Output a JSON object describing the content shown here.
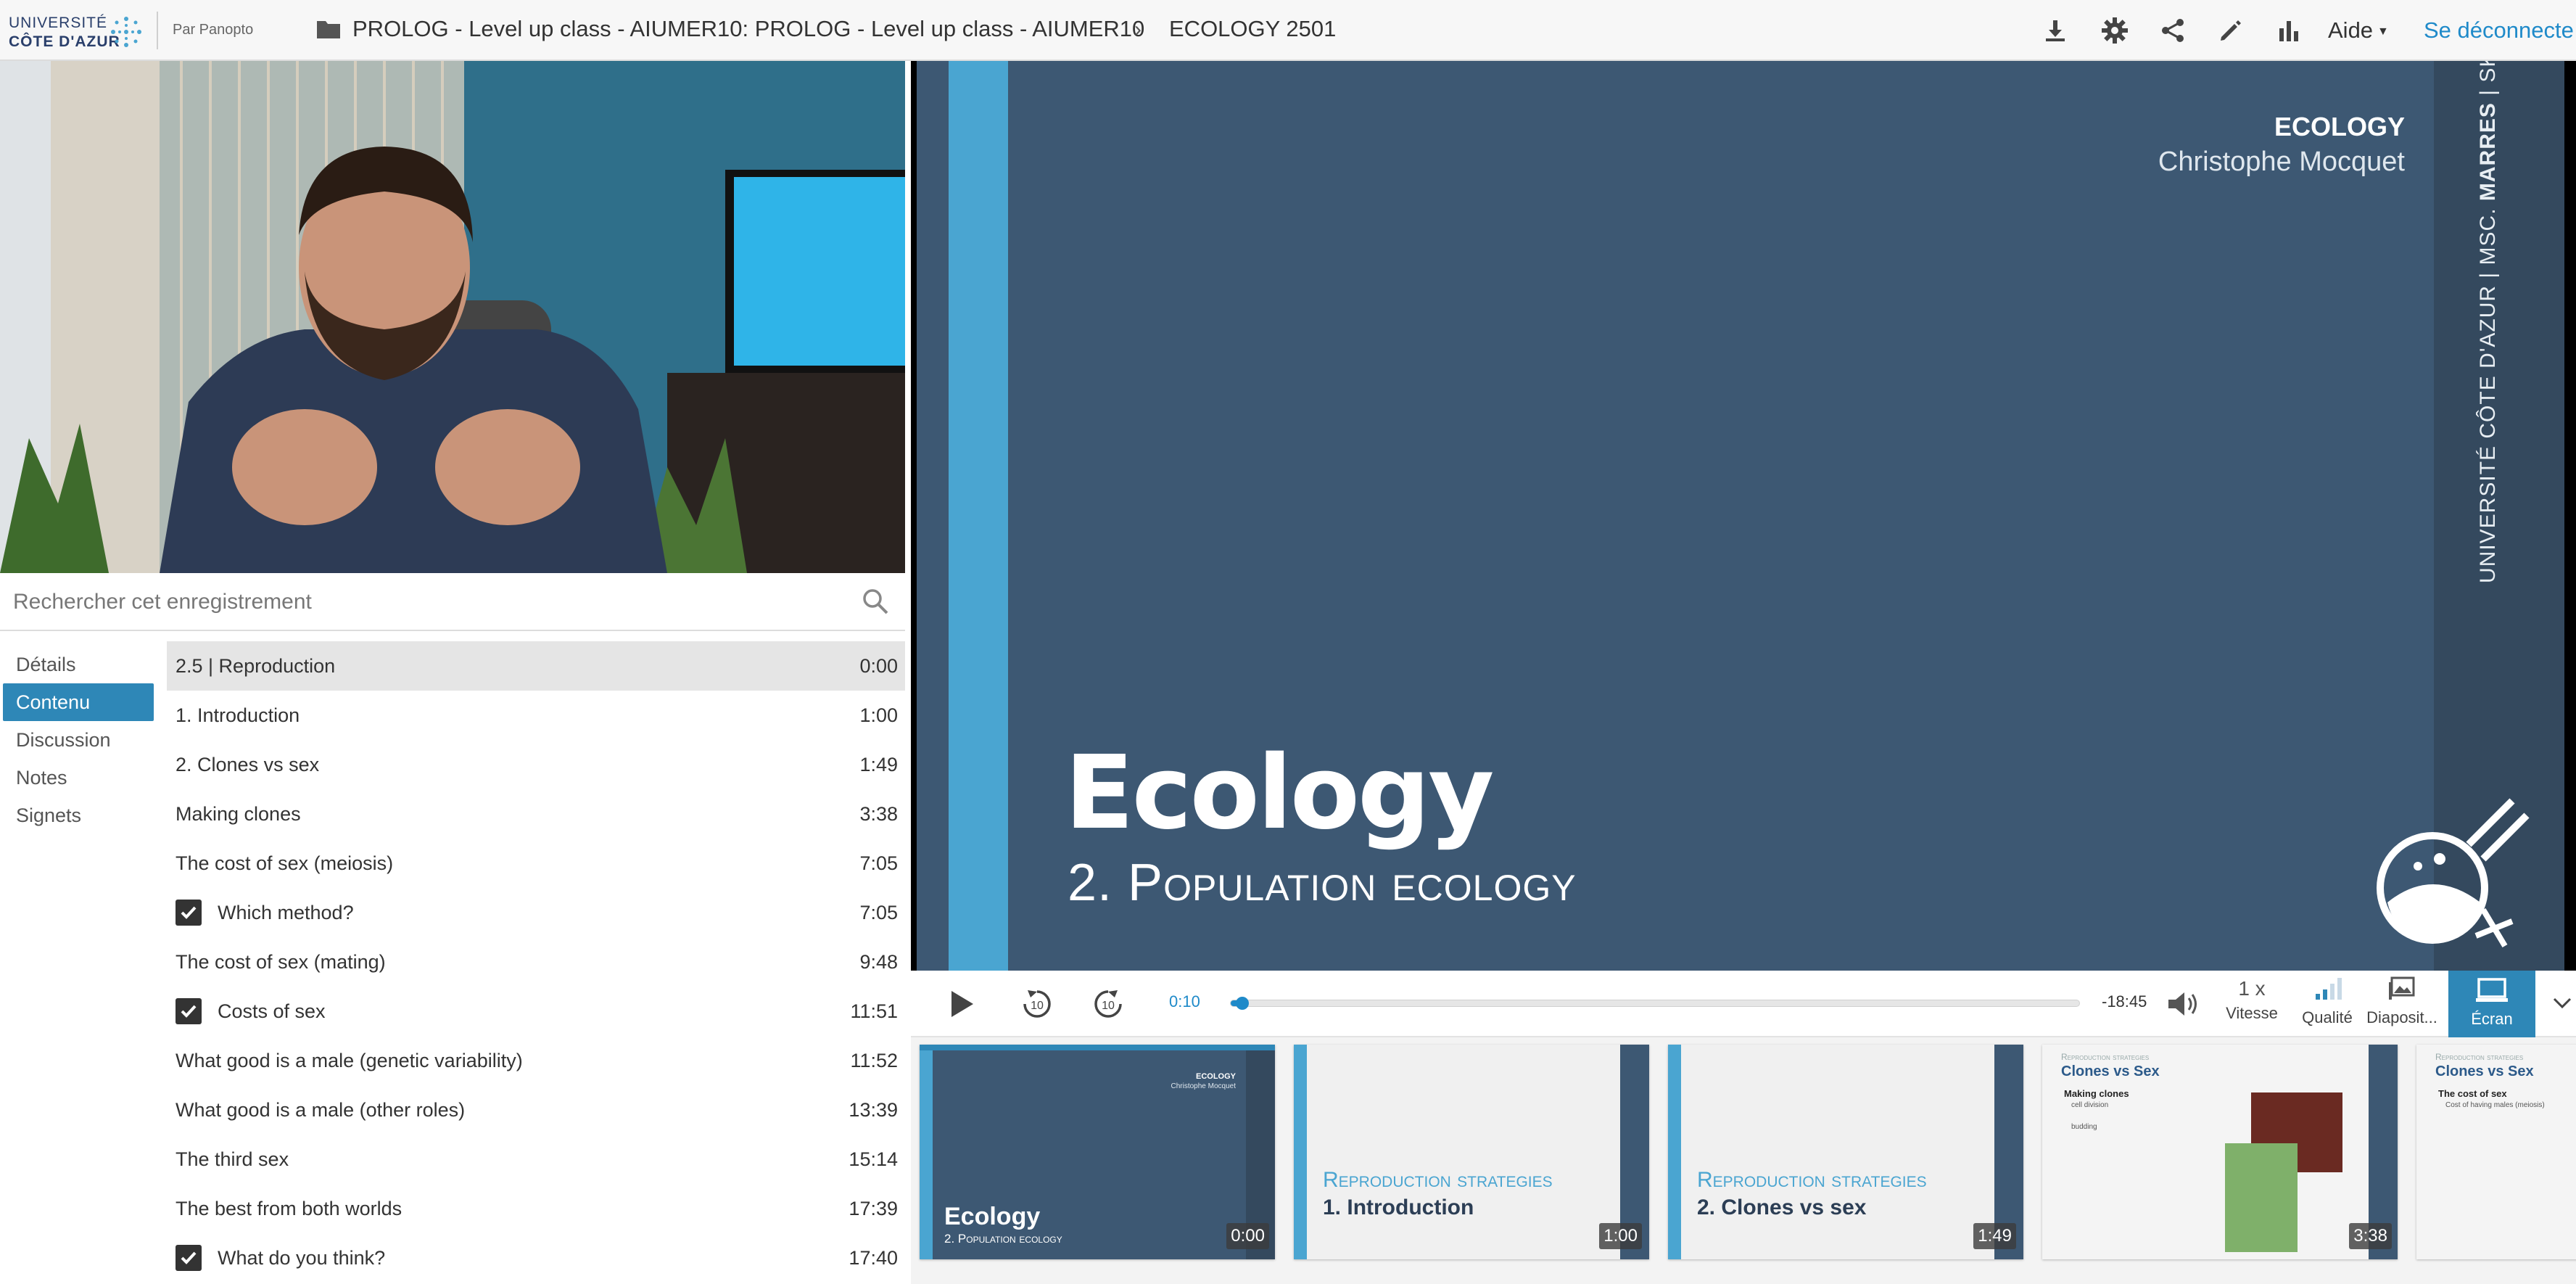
{
  "header": {
    "logo_line1": "UNIVERSITÉ",
    "logo_line2": "CÔTE D'AZUR",
    "by": "Par Panopto",
    "breadcrumb_folder": "PROLOG - Level up class - AIUMER10: PROLOG - Level up class - AIUMER10",
    "breadcrumb_session": "ECOLOGY 2501",
    "help": "Aide",
    "logout": "Se déconnecte"
  },
  "search": {
    "placeholder": "Rechercher cet enregistrement"
  },
  "tabs": [
    {
      "label": "Détails"
    },
    {
      "label": "Contenu"
    },
    {
      "label": "Discussion"
    },
    {
      "label": "Notes"
    },
    {
      "label": "Signets"
    }
  ],
  "contents": [
    {
      "title": "2.5 | Reproduction",
      "time": "0:00"
    },
    {
      "title": "1. Introduction",
      "time": "1:00"
    },
    {
      "title": "2. Clones vs sex",
      "time": "1:49"
    },
    {
      "title": "Making clones",
      "time": "3:38"
    },
    {
      "title": "The cost of sex (meiosis)",
      "time": "7:05"
    },
    {
      "title": "Which method?",
      "time": "7:05"
    },
    {
      "title": "The cost of sex (mating)",
      "time": "9:48"
    },
    {
      "title": "Costs of sex",
      "time": "11:51"
    },
    {
      "title": "What good is a male (genetic variability)",
      "time": "11:52"
    },
    {
      "title": "What good is a male (other roles)",
      "time": "13:39"
    },
    {
      "title": "The third sex",
      "time": "15:14"
    },
    {
      "title": "The best from both worlds",
      "time": "17:39"
    },
    {
      "title": "What do you think?",
      "time": "17:40"
    }
  ],
  "slide": {
    "course": "ECOLOGY",
    "author": "Christophe Mocquet",
    "title": "Ecology",
    "subtitle": "2. Population ecology",
    "vertical_a": "UNIVERSITÉ CÔTE D'AZUR | MSC. ",
    "vertical_b": "MARRES",
    "vertical_c": " | SKEMA"
  },
  "controls": {
    "current_time": "0:10",
    "remaining_time": "-18:45",
    "progress": 0.009,
    "speed_value": "1 x",
    "speed_label": "Vitesse",
    "quality_label": "Qualité",
    "slides_label": "Diaposit...",
    "screen_label": "Écran"
  },
  "thumbnails": [
    {
      "title": "Ecology",
      "subtitle": "2. Population ecology",
      "course": "ECOLOGY",
      "author": "Christophe Mocquet",
      "time": "0:00"
    },
    {
      "title": "Reproduction strategies",
      "subtitle": "1. Introduction",
      "time": "1:00"
    },
    {
      "title": "Reproduction strategies",
      "subtitle": "2. Clones vs sex",
      "time": "1:49"
    },
    {
      "kicker": "Reproduction strategies",
      "title": "Clones vs Sex",
      "b1": "Making clones",
      "b2": "cell division",
      "b3": "budding",
      "time": "3:38"
    },
    {
      "kicker": "Reproduction strategies",
      "title": "Clones vs Sex",
      "b1": "The cost of sex",
      "b2": "Cost of having males (meiosis)"
    }
  ],
  "colors": {
    "accent": "#2e87b7",
    "link": "#1f8ac9",
    "slide_bg": "#3d5873",
    "slide_stripe": "#4aa5d1"
  }
}
